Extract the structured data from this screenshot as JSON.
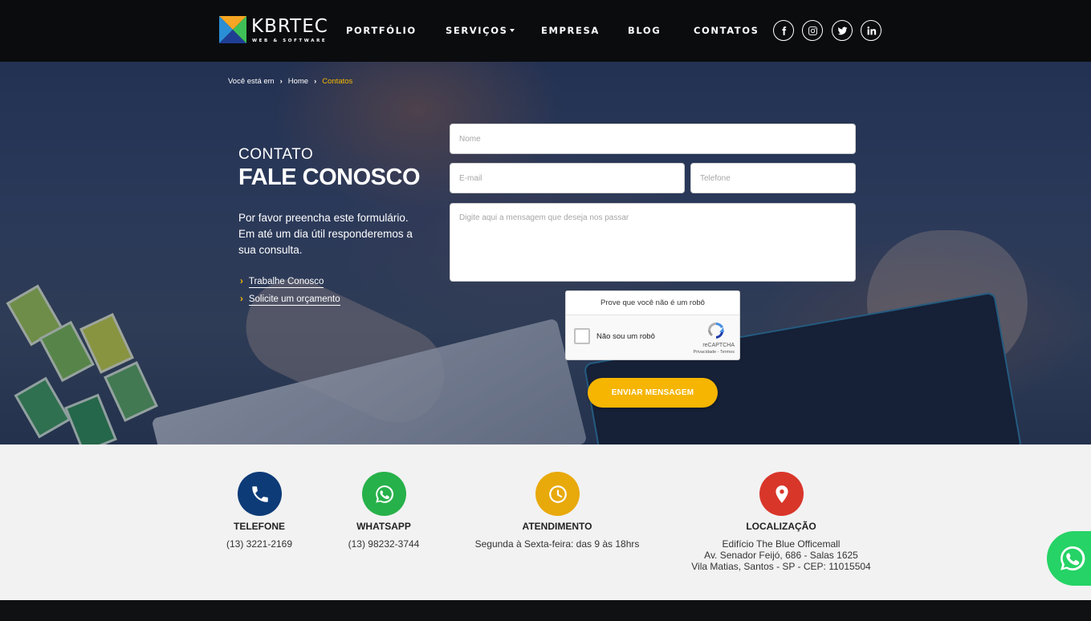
{
  "brand": {
    "name": "KBRTEC",
    "tagline": "WEB & SOFTWARE"
  },
  "nav": {
    "items": [
      "PORTFÓLIO",
      "SERVIÇOS",
      "EMPRESA",
      "BLOG",
      "CONTATOS"
    ],
    "dropdown_item": "SERVIÇOS"
  },
  "social": [
    "facebook-icon",
    "instagram-icon",
    "twitter-icon",
    "linkedin-icon"
  ],
  "breadcrumb": {
    "prefix": "Você está em",
    "home": "Home",
    "current": "Contatos"
  },
  "contact": {
    "kicker": "CONTATO",
    "title": "FALE CONOSCO",
    "description": "Por favor preencha este formulário. Em até um dia útil responderemos a sua consulta.",
    "links": [
      "Trabalhe Conosco",
      "Solicite um orçamento"
    ]
  },
  "form": {
    "name_placeholder": "Nome",
    "email_placeholder": "E-mail",
    "phone_placeholder": "Telefone",
    "message_placeholder": "Digite aqui a mensagem que deseja nos passar",
    "captcha_title": "Prove que você não é um robô",
    "captcha_label": "Não sou um robô",
    "captcha_brand": "reCAPTCHA",
    "captcha_terms": "Privacidade - Termos",
    "submit": "ENVIAR MENSAGEM"
  },
  "info": {
    "phone": {
      "title": "TELEFONE",
      "text": "(13) 3221-2169"
    },
    "whatsapp": {
      "title": "WHATSAPP",
      "text": "(13) 98232-3744"
    },
    "hours": {
      "title": "ATENDIMENTO",
      "text": "Segunda à Sexta-feira: das 9 às 18hrs"
    },
    "location": {
      "title": "LOCALIZAÇÃO",
      "line1": "Edifício The Blue Officemall",
      "line2": "Av. Senador Feijó, 686 - Salas 1625",
      "line3": "Vila Matias, Santos - SP - CEP: 11015504"
    }
  },
  "colors": {
    "accent": "#f5b500",
    "header_bg": "#0b0c0e",
    "phone_icon": "#0d3b78",
    "whatsapp_icon": "#27b14a",
    "hours_icon": "#e8a90b",
    "location_icon": "#d9362a",
    "whatsapp_float": "#25d366"
  }
}
